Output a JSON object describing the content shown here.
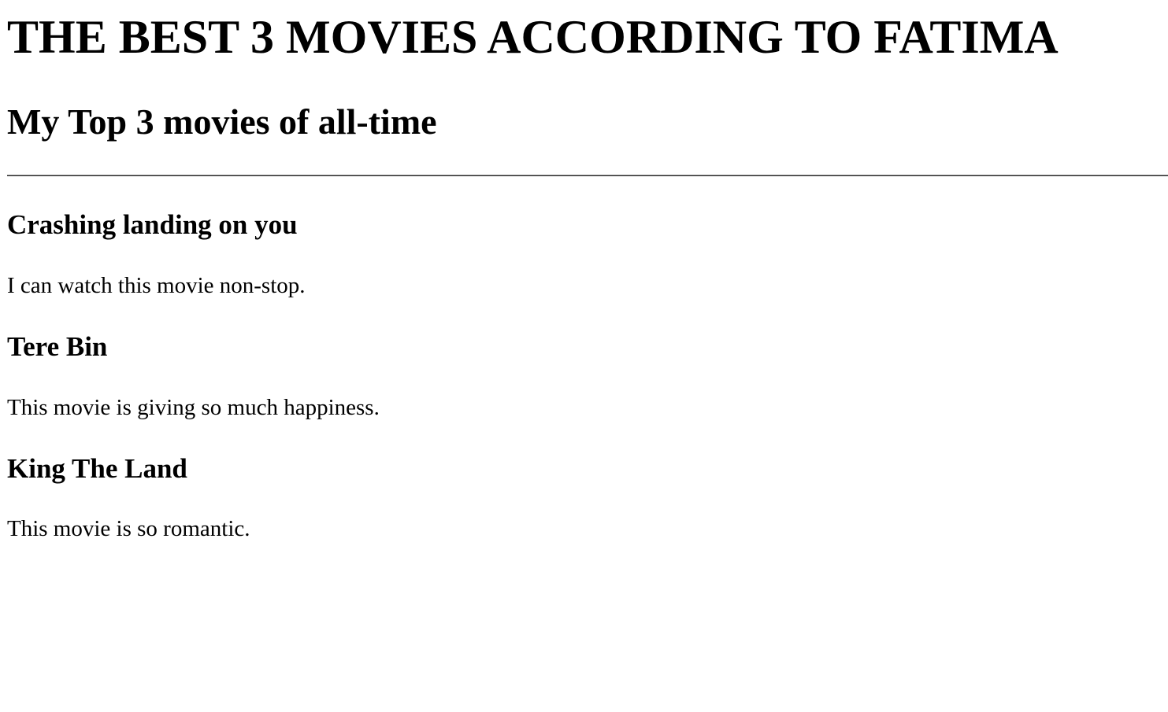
{
  "page": {
    "title": "THE BEST 3 MOVIES ACCORDING TO FATIMA",
    "subtitle": "My Top 3 movies of all-time"
  },
  "movies": [
    {
      "title": "Crashing landing on you",
      "description": "I can watch this movie non-stop."
    },
    {
      "title": "Tere Bin",
      "description": "This movie is giving so much happiness."
    },
    {
      "title": "King The Land",
      "description": "This movie is so romantic."
    }
  ]
}
